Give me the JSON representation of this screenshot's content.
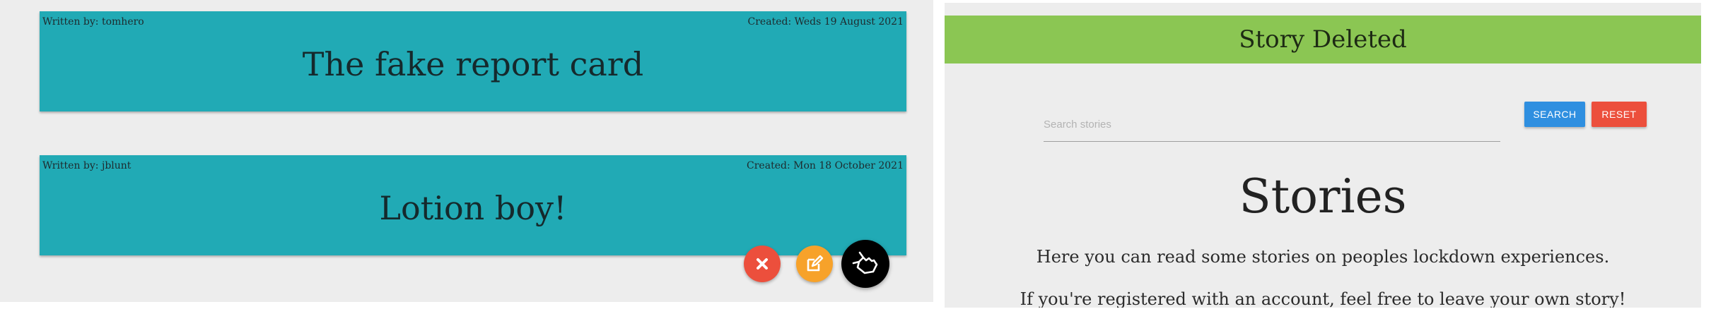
{
  "left_panel": {
    "cards": [
      {
        "author": "Written by: tomhero",
        "created": "Created: Weds 19 August 2021",
        "title": "The fake report card"
      },
      {
        "author": "Written by: jblunt",
        "created": "Created: Mon 18 October 2021",
        "title": "Lotion boy!"
      }
    ],
    "fab": {
      "delete_icon": "close-icon",
      "edit_icon": "edit-icon",
      "main_icon": "hand-pointer-icon",
      "colors": {
        "delete": "#ec4f3c",
        "edit": "#f7a22a",
        "main": "#000000"
      }
    }
  },
  "right_panel": {
    "banner": {
      "text": "Story Deleted",
      "color": "#8bc653"
    },
    "search": {
      "placeholder": "Search stories",
      "value": ""
    },
    "buttons": {
      "search_label": "SEARCH",
      "reset_label": "RESET"
    },
    "heading": "Stories",
    "intro": [
      "Here you can read some stories on peoples lockdown experiences.",
      "If you're registered with an account, feel free to leave your own story!"
    ]
  },
  "colors": {
    "card": "#21aab5",
    "background": "#ededed",
    "search_button": "#2f8fe0",
    "reset_button": "#ec4f3c"
  }
}
